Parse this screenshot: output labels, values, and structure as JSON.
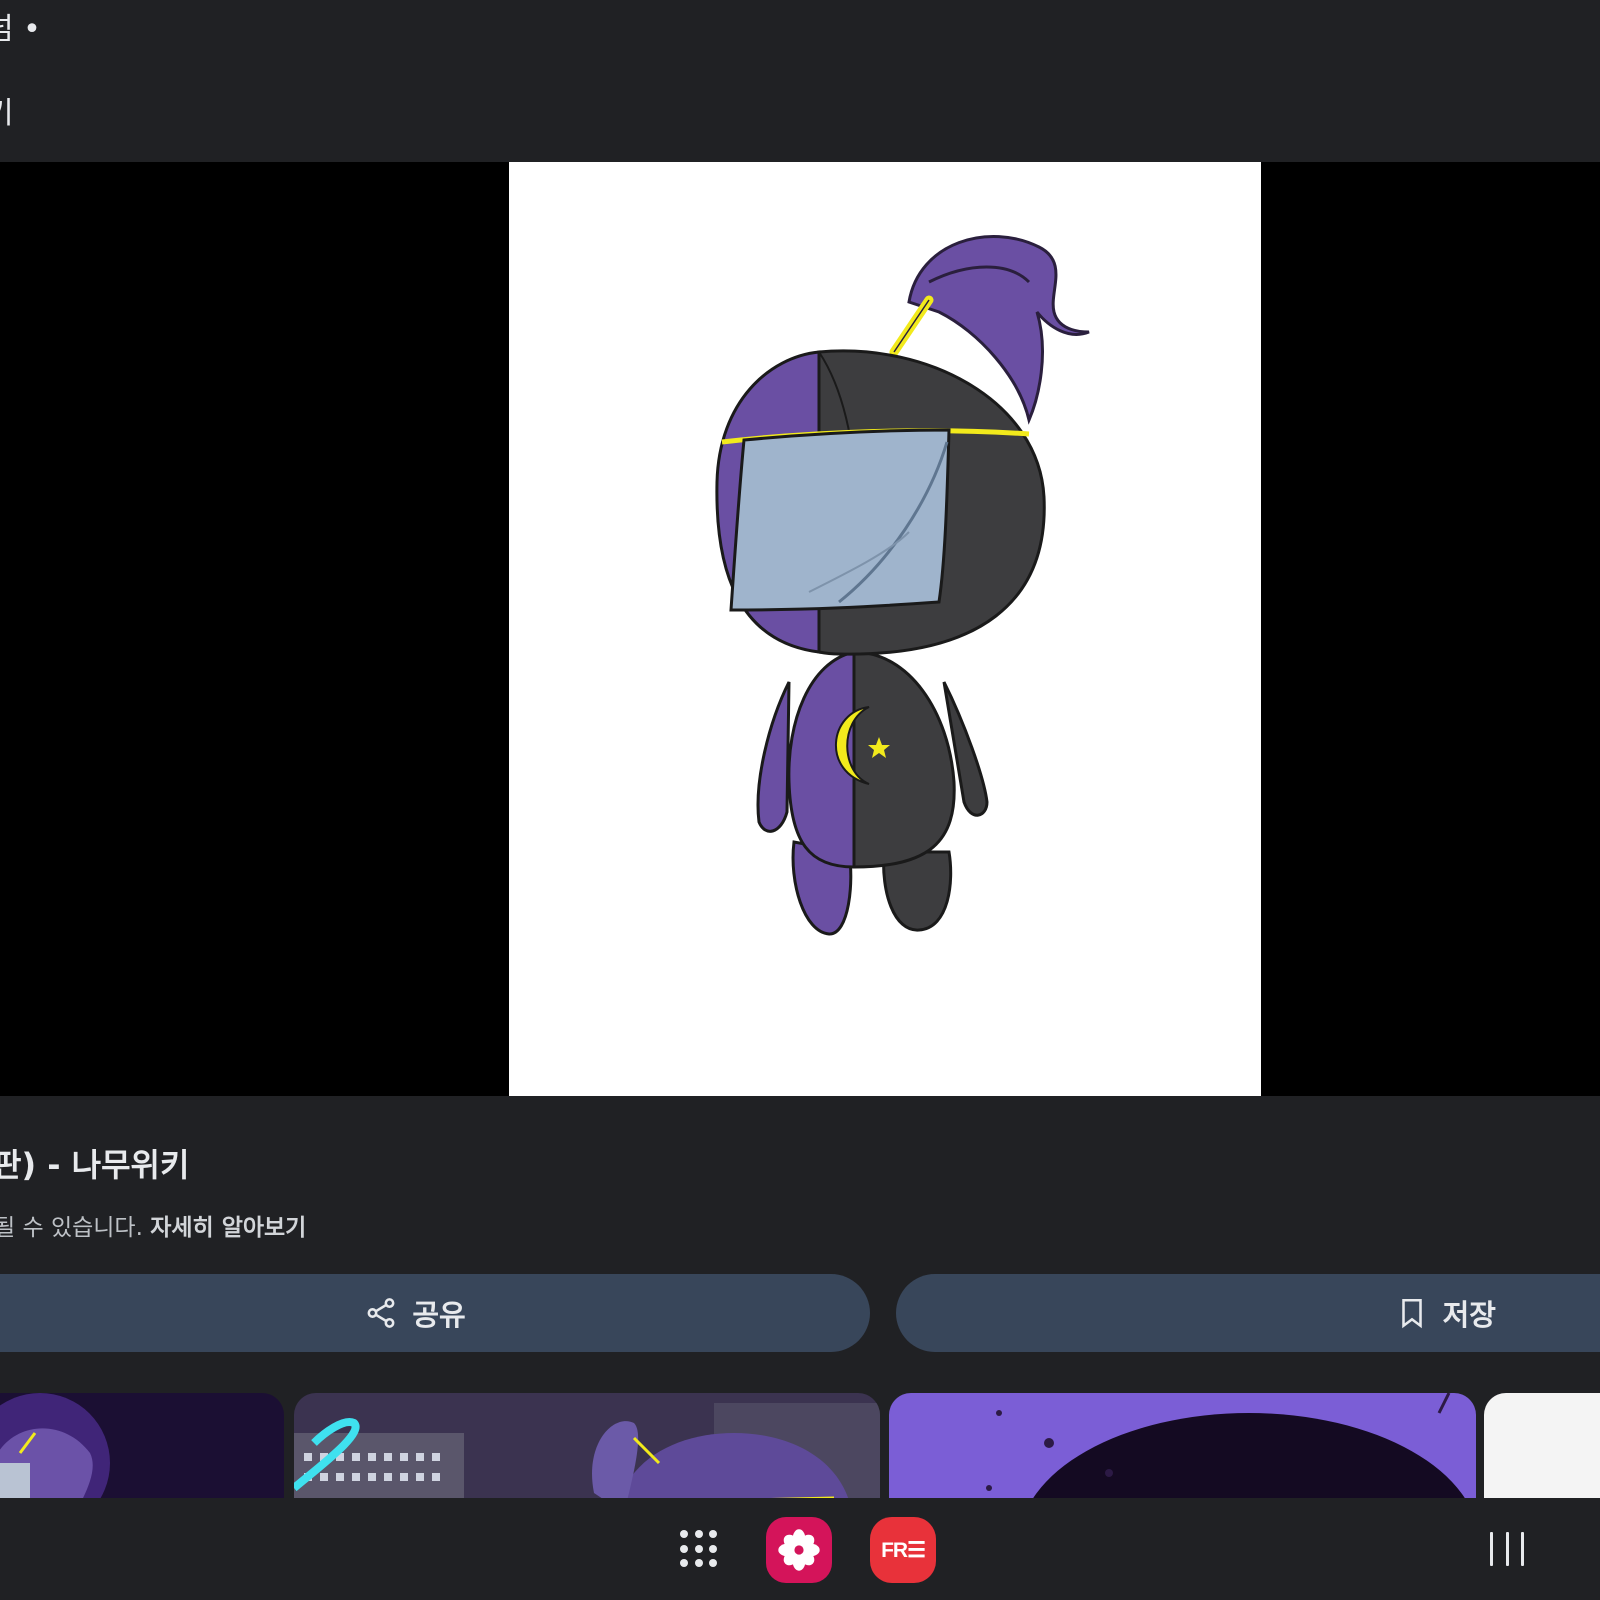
{
  "header": {
    "title": "넘 •",
    "subtitle": "키"
  },
  "result": {
    "title": "판) - 나무위키",
    "notice": "될 수 있습니다. ",
    "learn_more": "자세히 알아보기"
  },
  "actions": {
    "share_label": "공유",
    "save_label": "저장"
  },
  "navbar": {
    "free_app_label": "FR☰"
  },
  "colors": {
    "background": "#202124",
    "button": "#38465a",
    "character_purple": "#6a4fa3",
    "character_dark": "#3d3d3f",
    "accent_yellow": "#f2ea1c"
  }
}
